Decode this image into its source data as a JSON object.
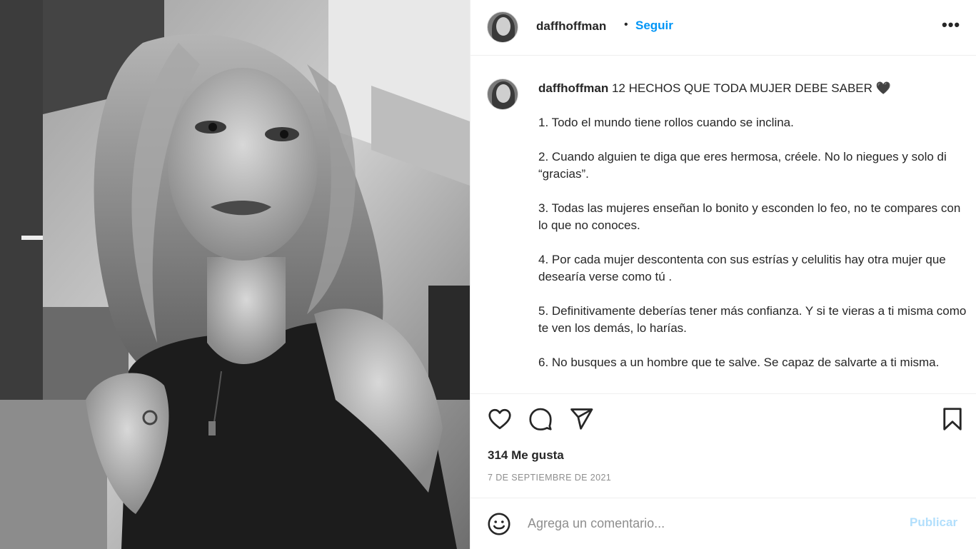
{
  "post": {
    "username": "daffhoffman",
    "follow_label": "Seguir",
    "separator": "•",
    "more_label": "•••",
    "caption_title": "12 HECHOS QUE TODA MUJER DEBE SABER 🖤",
    "caption_items": [
      "1. Todo el mundo tiene rollos cuando se inclina.",
      "2. Cuando alguien te diga que eres hermosa, créele. No lo niegues y solo di “gracias”.",
      "3. Todas las mujeres enseñan lo bonito y esconden lo feo, no te compares con lo que no conoces.",
      "4. Por cada mujer descontenta con sus estrías y celulitis hay otra mujer que desearía verse como tú .",
      "5. Definitivamente deberías tener más confianza. Y si te vieras a ti misma como te ven los demás, lo harías.",
      "6. No busques a un hombre que te salve. Se capaz de salvarte a ti misma."
    ],
    "likes": "314 Me gusta",
    "date": "7 DE SEPTIEMBRE DE 2021"
  },
  "comment": {
    "placeholder": "Agrega un comentario...",
    "publish_label": "Publicar"
  },
  "icons": {
    "like": "heart-icon",
    "comment": "comment-icon",
    "share": "share-icon",
    "save": "bookmark-icon",
    "emoji": "emoji-icon",
    "more": "more-options-icon"
  },
  "colors": {
    "accent": "#0095f6",
    "publish_disabled": "#b2dffc",
    "text": "#262626",
    "muted": "#8e8e8e"
  }
}
